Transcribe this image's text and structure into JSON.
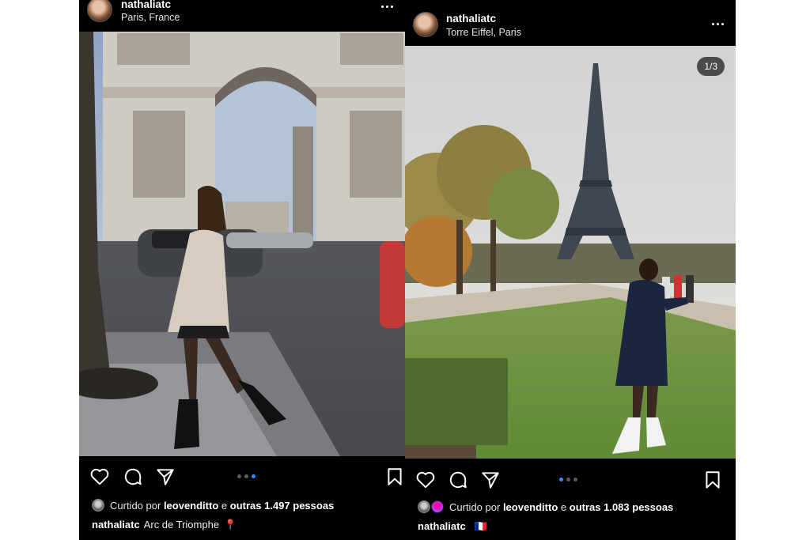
{
  "posts": [
    {
      "username": "nathaliatc",
      "location": "Paris, France",
      "photo_description_icon": "arc-de-triomphe-photo",
      "liked_by_prefix": "Curtido por",
      "liked_by_user": "leovenditto",
      "liked_by_conj": "e",
      "liked_by_others": "outras 1.497 pessoas",
      "caption_user": "nathaliatc",
      "caption_text": "Arc de Triomphe",
      "caption_emoji": "📍",
      "carousel": {
        "count": 3,
        "active": 3
      }
    },
    {
      "username": "nathaliatc",
      "location": "Torre Eiffel, Paris",
      "photo_description_icon": "eiffel-tower-photo",
      "counter": "1/3",
      "liked_by_prefix": "Curtido por",
      "liked_by_user": "leovenditto",
      "liked_by_conj": "e",
      "liked_by_others": "outras 1.083 pessoas",
      "caption_user": "nathaliatc",
      "caption_text": "",
      "caption_emoji": "🇫🇷",
      "carousel": {
        "count": 3,
        "active": 1
      }
    }
  ],
  "icons": {
    "like": "heart-icon",
    "comment": "comment-icon",
    "share": "share-icon",
    "save": "bookmark-icon",
    "more": "more-options-icon"
  },
  "colors": {
    "background": "#000000",
    "active_dot": "#2f8cff",
    "inactive_dot": "#5c5c5c"
  }
}
